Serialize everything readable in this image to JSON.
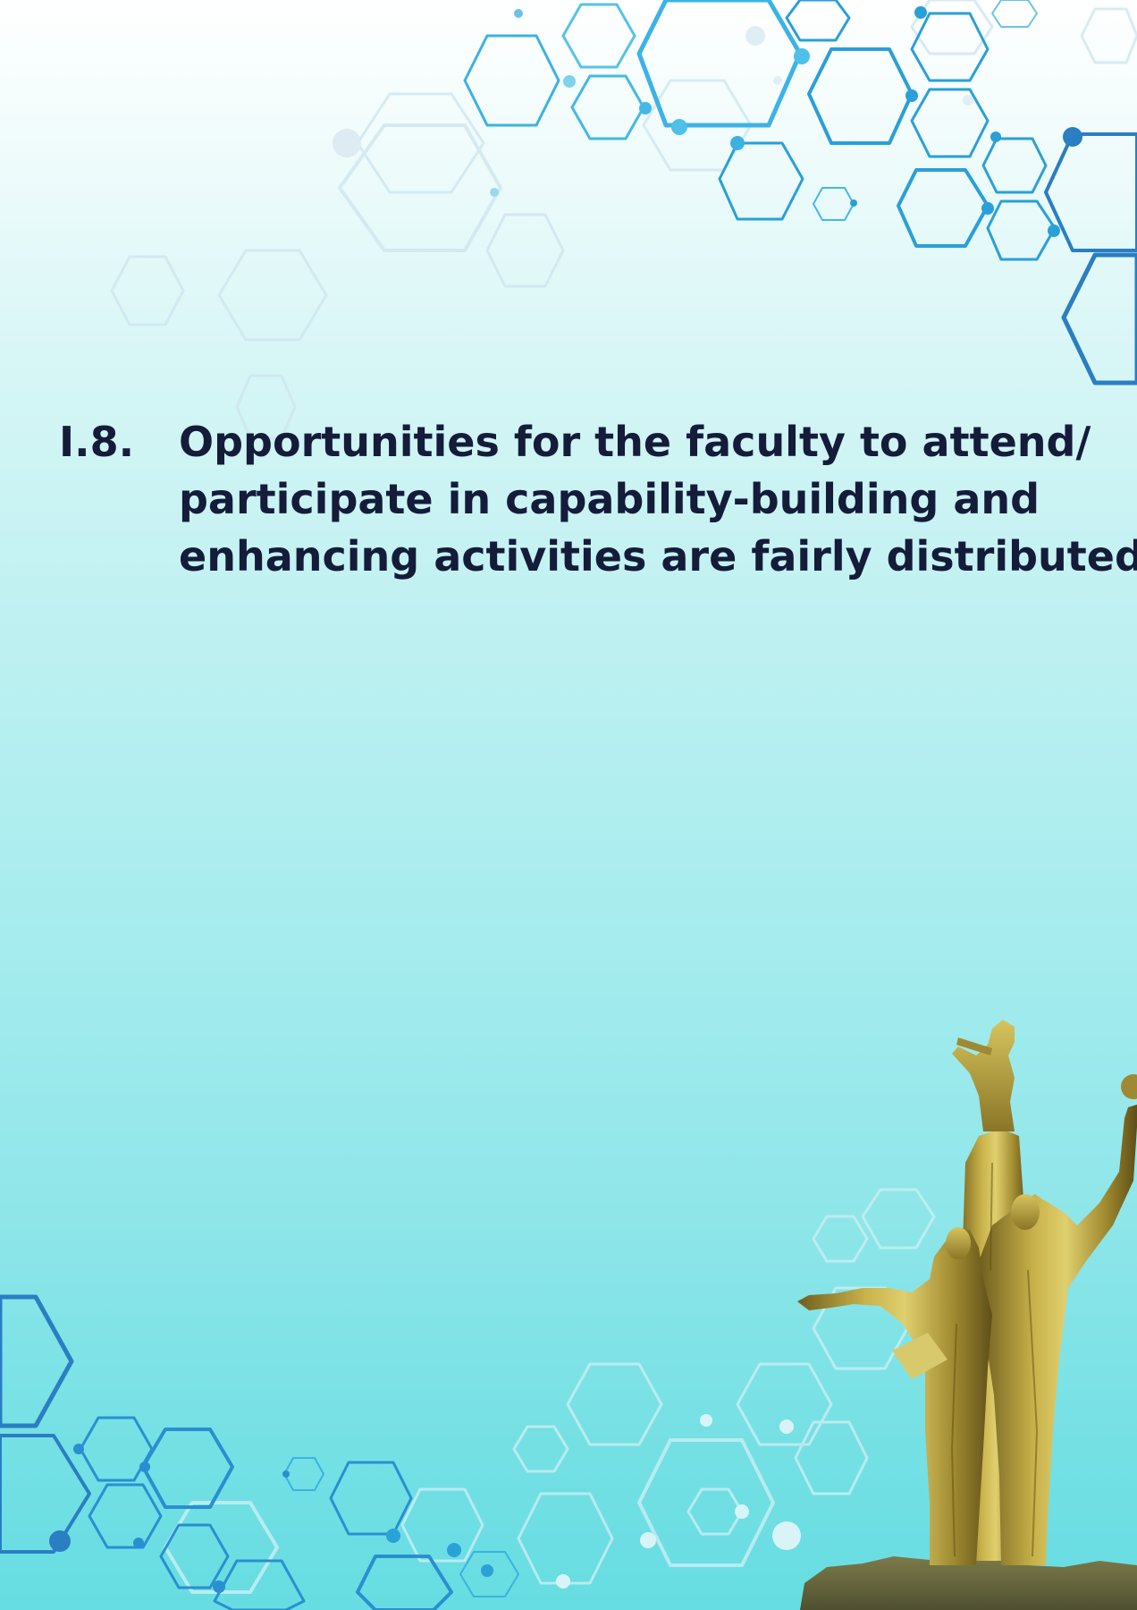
{
  "item": {
    "number": "I.8.",
    "lines": [
      "Opportunities for the faculty to attend/",
      "participate in capability-building and",
      "enhancing activities are fairly distributed."
    ]
  },
  "colors": {
    "heading_text": "#141c3a",
    "hex_blue": "#2a9fd8",
    "hex_dark_blue": "#2a7ec2",
    "statue_gold": "#b9a33a"
  }
}
